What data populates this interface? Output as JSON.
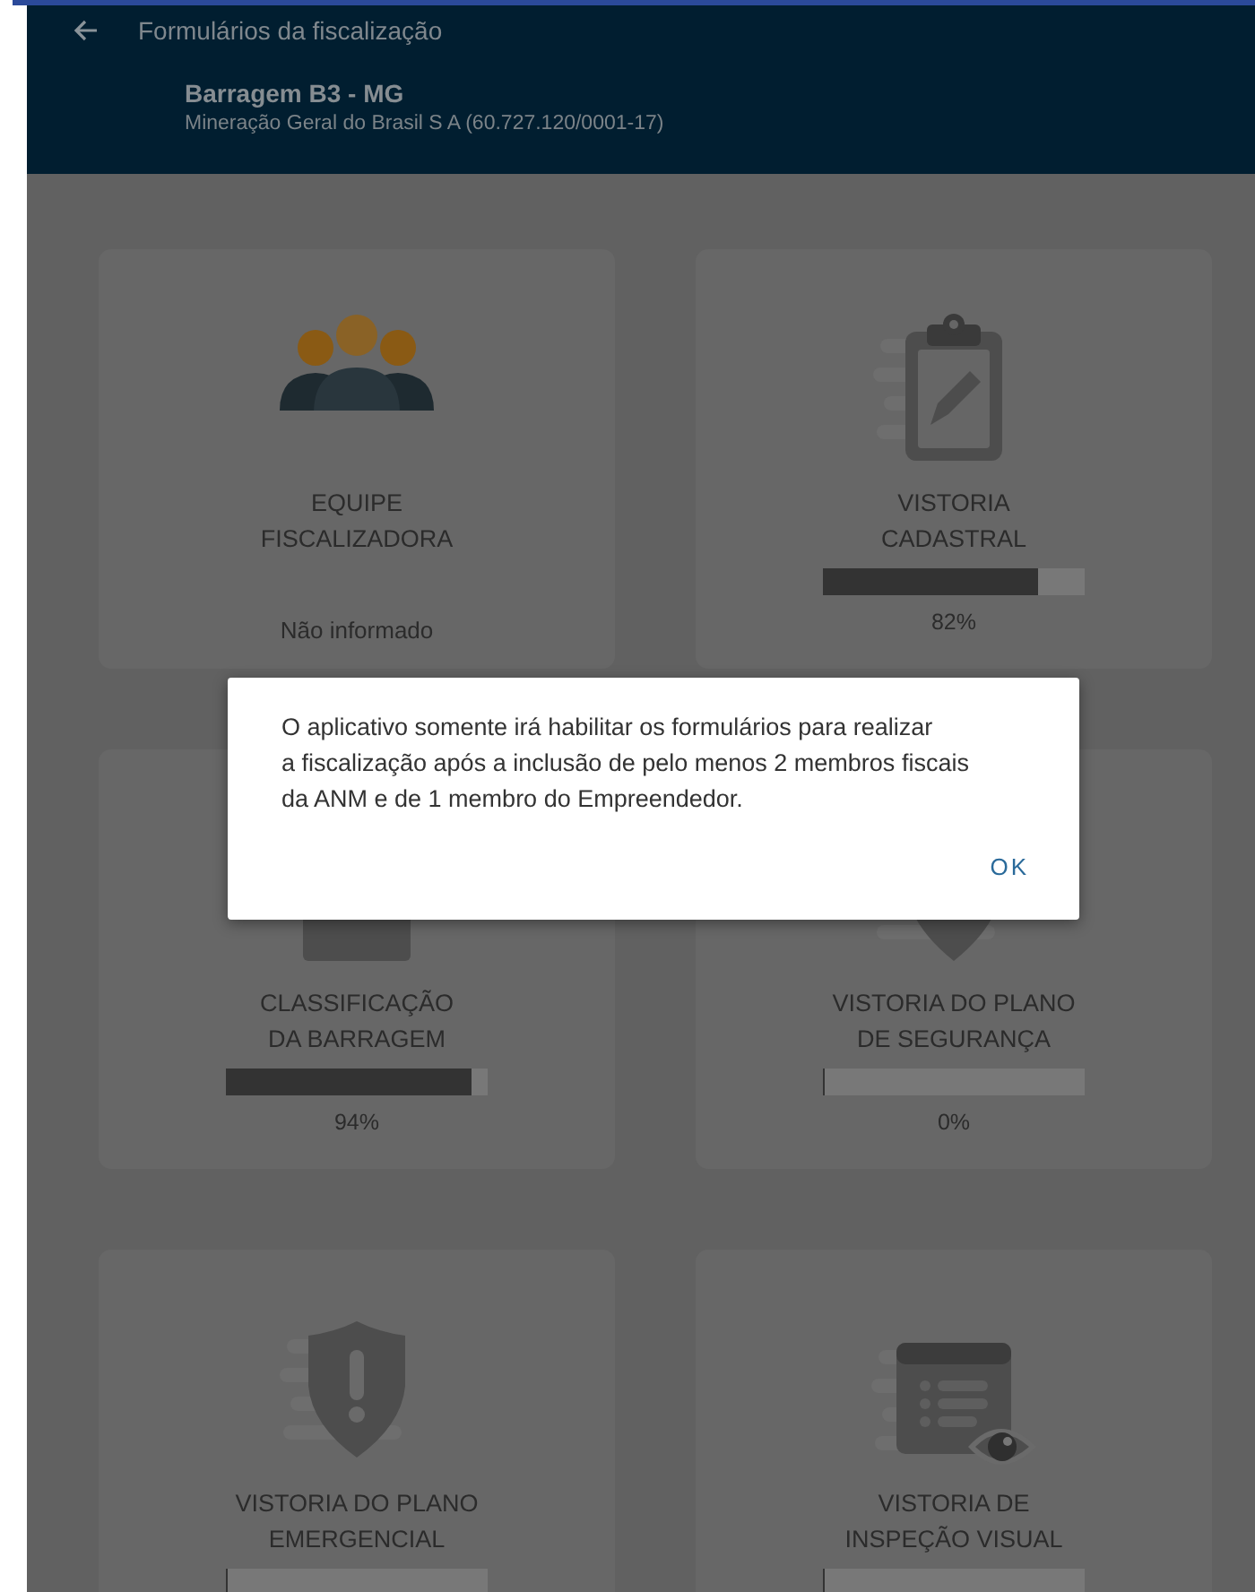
{
  "header": {
    "title": "Formulários da fiscalização",
    "dam": "Barragem B3 - MG",
    "company": "Mineração Geral do Brasil S A (60.727.120/0001-17)"
  },
  "cards": [
    {
      "kind": "status",
      "title": [
        "EQUIPE",
        "FISCALIZADORA"
      ],
      "status": "Não informado"
    },
    {
      "kind": "progress",
      "title": [
        "VISTORIA",
        "CADASTRAL"
      ],
      "level": 0.82,
      "reading": "82%"
    },
    {
      "kind": "progress",
      "title": [
        "CLASSIFICAÇÃO",
        "DA BARRAGEM"
      ],
      "level": 0.94,
      "reading": "94%"
    },
    {
      "kind": "progress",
      "title": [
        "VISTORIA DO PLANO",
        "DE SEGURANÇA"
      ],
      "level": 0,
      "reading": "0%"
    },
    {
      "kind": "progress",
      "title": [
        "VISTORIA DO PLANO",
        "EMERGENCIAL"
      ],
      "level": 0
    },
    {
      "kind": "progress",
      "title": [
        "VISTORIA DE",
        "INSPEÇÃO VISUAL"
      ],
      "level": 0
    }
  ],
  "dialog": {
    "message": [
      "O aplicativo somente irá habilitar os formulários para realizar",
      "a fiscalização após a inclusão de pelo menos 2 membros fiscais",
      "da ANM e de 1 membro do Empreendedor."
    ],
    "button": "OK"
  }
}
